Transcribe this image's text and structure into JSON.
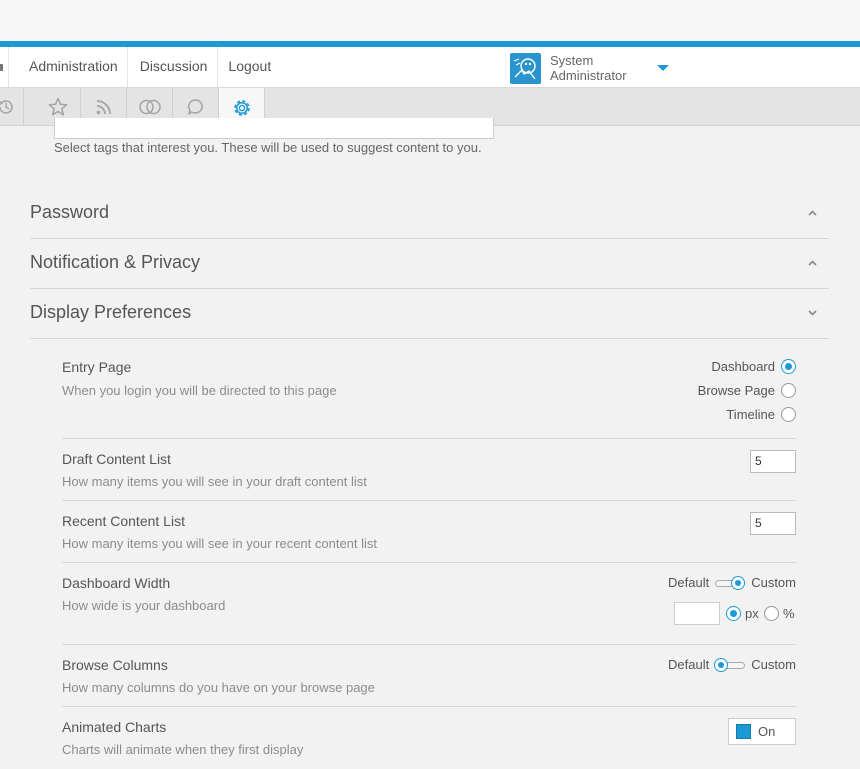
{
  "nav": {
    "links": [
      {
        "label": "Administration"
      },
      {
        "label": "Discussion"
      },
      {
        "label": "Logout"
      }
    ],
    "user": {
      "name_line1": "System",
      "name_line2": "Administrator"
    }
  },
  "icon_tabs": [
    {
      "icon": "history-icon"
    },
    {
      "icon": "star-icon"
    },
    {
      "icon": "rss-icon"
    },
    {
      "icon": "circles-icon"
    },
    {
      "icon": "chat-bubble-icon"
    },
    {
      "icon": "gear-icon",
      "active": true
    }
  ],
  "tags": {
    "help": "Select tags that interest you. These will be used to suggest content to you."
  },
  "sections": {
    "password": "Password",
    "notification": "Notification & Privacy",
    "display": "Display Preferences"
  },
  "prefs": {
    "entry_page": {
      "label": "Entry Page",
      "desc": "When you login you will be directed to this page",
      "options": [
        "Dashboard",
        "Browse Page",
        "Timeline"
      ],
      "selected": "Dashboard"
    },
    "draft_list": {
      "label": "Draft Content List",
      "desc": "How many items you will see in your draft content list",
      "value": "5"
    },
    "recent_list": {
      "label": "Recent Content List",
      "desc": "How many items you will see in your recent content list",
      "value": "5"
    },
    "dashboard_width": {
      "label": "Dashboard Width",
      "desc": "How wide is your dashboard",
      "left": "Default",
      "right": "Custom",
      "state": "Custom",
      "unit_px": "px",
      "unit_pct": "%",
      "unit_selected": "px"
    },
    "browse_columns": {
      "label": "Browse Columns",
      "desc": "How many columns do you have on your browse page",
      "left": "Default",
      "right": "Custom",
      "state": "Default"
    },
    "animated_charts": {
      "label": "Animated Charts",
      "desc": "Charts will animate when they first display",
      "toggle": "On"
    }
  },
  "colors": {
    "accent": "#1c9ad6"
  }
}
